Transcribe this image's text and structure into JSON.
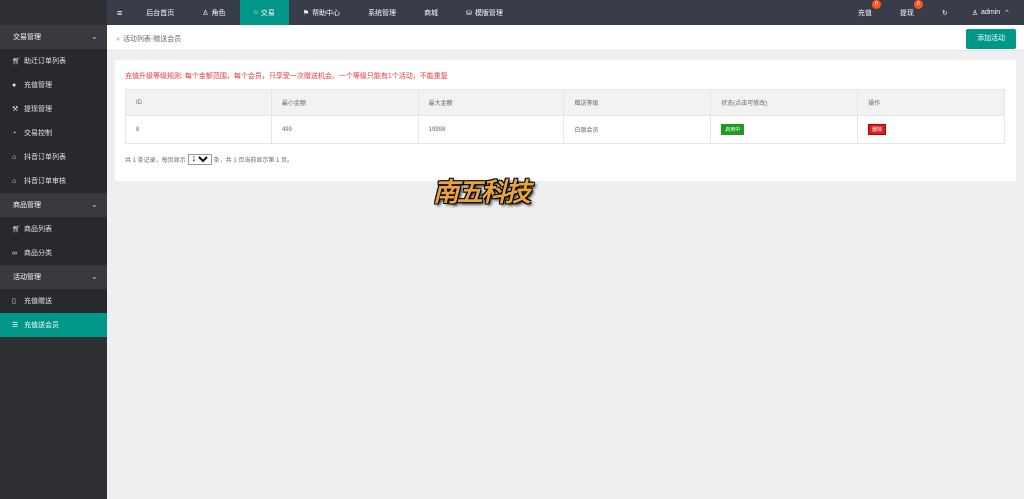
{
  "sidebar": {
    "groups": [
      {
        "label": "交易管理",
        "items": [
          {
            "icon": "cart-icon",
            "label": "助迁订单列表"
          },
          {
            "icon": "chat-icon",
            "label": "充值管理"
          },
          {
            "icon": "hammer-icon",
            "label": "提现管理"
          },
          {
            "icon": "gauge-icon",
            "label": "交易控制"
          },
          {
            "icon": "bank-icon",
            "label": "抖音订单列表"
          },
          {
            "icon": "bank-icon",
            "label": "抖音订单审核"
          }
        ]
      },
      {
        "label": "商品管理",
        "items": [
          {
            "icon": "cart-icon",
            "label": "商品列表"
          },
          {
            "icon": "link-icon",
            "label": "商品分类"
          }
        ]
      },
      {
        "label": "活动管理",
        "items": [
          {
            "icon": "mobile-icon",
            "label": "充值赠送"
          },
          {
            "icon": "list-icon",
            "label": "充值送会员"
          }
        ]
      }
    ]
  },
  "topbar": {
    "menu": [
      {
        "label": "后台首页",
        "icon": ""
      },
      {
        "label": "角色",
        "icon": "user-icon"
      },
      {
        "label": "交易",
        "icon": "bank-icon"
      },
      {
        "label": "帮助中心",
        "icon": "flag-icon"
      },
      {
        "label": "系统管理",
        "icon": ""
      },
      {
        "label": "商城",
        "icon": ""
      },
      {
        "label": "模版管理",
        "icon": "database-icon"
      }
    ],
    "recharge_label": "充值",
    "recharge_badge": "0",
    "withdraw_label": "提现",
    "withdraw_badge": "0",
    "admin_label": "admin"
  },
  "breadcrumb": {
    "separator": "»",
    "path": "活动列表-赠送会员"
  },
  "add_button_label": "添加活动",
  "notice": "充值升级等级规则: 每个金额范围，每个会员，只享受一次赠送机会。一个等级只能有1个活动，不能重复",
  "table": {
    "headers": [
      "ID",
      "最小金额",
      "最大金额",
      "赠送等级",
      "状态(点击可修改)",
      "操作"
    ],
    "rows": [
      {
        "id": "8",
        "min": "499",
        "max": "19998",
        "level": "白银会员",
        "status": "启用中",
        "action": "删除"
      }
    ]
  },
  "pager": {
    "prefix": "共 1 条记录，每页显示",
    "page_size": "20",
    "suffix": "条，共 1 页当前显示第 1 页。"
  },
  "watermark_text": "南五科技",
  "colors": {
    "accent": "#009688",
    "sidebar_bg": "#2f3033",
    "topbar_bg": "#393d49",
    "notice": "#e8343b",
    "badge": "#ff5722"
  }
}
